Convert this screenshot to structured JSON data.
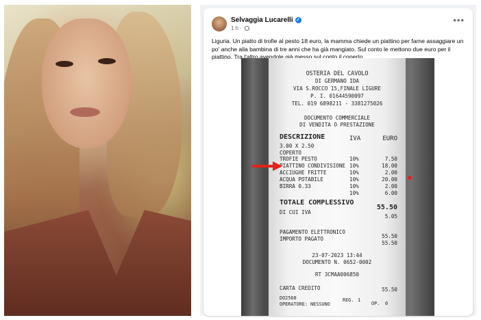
{
  "post": {
    "author": "Selvaggia Lucarelli",
    "time": "1 h",
    "more": "•••",
    "text": "Liguria. Un piatto di trofie al pesto 18 euro, la mamma chiede un piattino per farne assaggiare un po' anche alla bambina di tre anni che ha già mangiato. Sul conto le mettono due euro per il piattino. Tra l'altro avendole già messo sul conto il coperto."
  },
  "receipt": {
    "name": "OSTERIA DEL CAVOLO",
    "owner": "DI GERMANO IDA",
    "address": "VIA S.ROCCO 15,FINALE LIGURE",
    "piva": "P. I. 01644590097",
    "tel": "TEL. 019 6898211 - 3381275026",
    "doc1": "DOCUMENTO COMMERCIALE",
    "doc2": "DI VENDITA O PRESTAZIONE",
    "hdr_desc": "DESCRIZIONE",
    "hdr_iva": "IVA",
    "hdr_euro": "EURO",
    "qty_line": "3.00 X 2.50",
    "items": [
      {
        "desc": "COPERTO",
        "iva": "10%",
        "euro": "7.50"
      },
      {
        "desc": "TROFIE PESTO",
        "iva": "10%",
        "euro": "18.00"
      },
      {
        "desc": "PIATTINO CONDIVISIONE",
        "iva": "10%",
        "euro": "2.00"
      },
      {
        "desc": "ACCIUGHE FRITTE",
        "iva": "10%",
        "euro": "20.00"
      },
      {
        "desc": "ACQUA POTABILE",
        "iva": "10%",
        "euro": "2.00"
      },
      {
        "desc": "BIRRA 0.33",
        "iva": "10%",
        "euro": "6.00"
      }
    ],
    "total_label": "TOTALE COMPLESSIVO",
    "total": "55.50",
    "iva_label": "DI CUI IVA",
    "iva_value": "5.05",
    "pay_label": "PAGAMENTO ELETTRONICO",
    "pay_value": "55.50",
    "paid_label": "IMPORTO PAGATO",
    "paid_value": "55.50",
    "datetime": "23-07-2023 13:44",
    "doc_number": "DOCUMENTO N. 0652-0002",
    "rt": "RT 3CMAA006850",
    "card_label": "CARTA CREDITO",
    "card_value": "55.50",
    "code": "DO2560",
    "reg": "REG.",
    "reg_value": "1",
    "operator": "OPERATORE: NESSUNO",
    "op": "OP.",
    "op_value": "0"
  },
  "colors": {
    "annotation": "#e2231a",
    "verified": "#1877f2"
  }
}
